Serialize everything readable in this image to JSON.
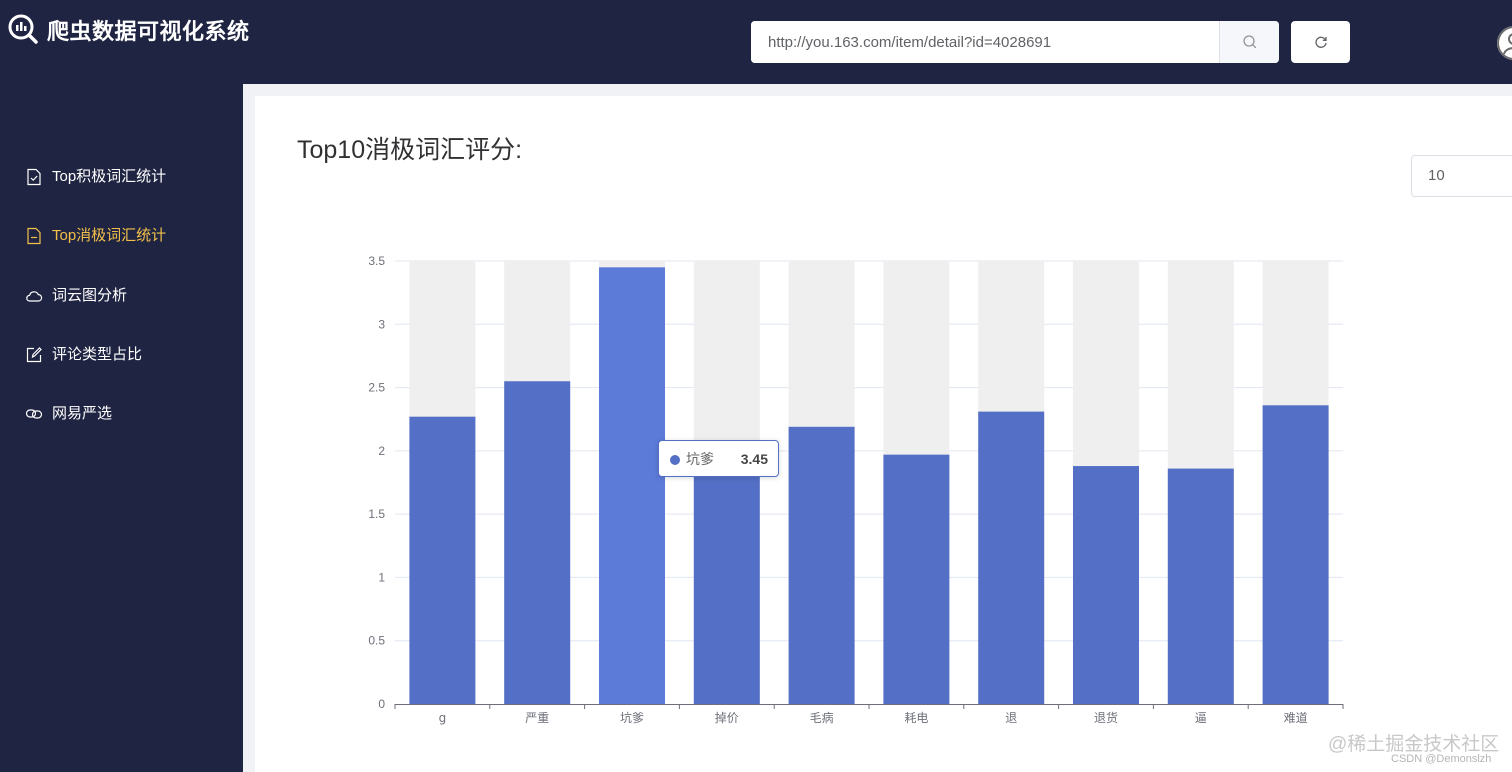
{
  "app": {
    "title": "爬虫数据可视化系统",
    "logo_icon": "bar-chart-search-icon"
  },
  "header": {
    "url_value": "http://you.163.com/item/detail?id=4028691",
    "search_icon": "search-icon",
    "refresh_icon": "refresh-icon",
    "avatar_icon": "user-avatar-icon"
  },
  "sidebar": {
    "items": [
      {
        "label": "Top积极词汇统计",
        "icon": "document-check-icon",
        "active": false
      },
      {
        "label": "Top消极词汇统计",
        "icon": "document-minus-icon",
        "active": true
      },
      {
        "label": "词云图分析",
        "icon": "cloud-icon",
        "active": false
      },
      {
        "label": "评论类型占比",
        "icon": "edit-icon",
        "active": false
      },
      {
        "label": "网易严选",
        "icon": "link-icon",
        "active": false
      }
    ]
  },
  "main": {
    "title": "Top10消极词汇评分:",
    "topn_value": "10"
  },
  "chart_data": {
    "type": "bar",
    "categories": [
      "g",
      "严重",
      "坑爹",
      "掉价",
      "毛病",
      "耗电",
      "退",
      "退货",
      "逼",
      "难道"
    ],
    "values": [
      2.27,
      2.55,
      3.45,
      1.95,
      2.19,
      1.97,
      2.31,
      1.88,
      1.86,
      2.36
    ],
    "ylim": [
      0,
      3.5
    ],
    "yticks": [
      0,
      0.5,
      1,
      1.5,
      2,
      2.5,
      3,
      3.5
    ],
    "background_bars": true,
    "bar_color": "#5470c6",
    "highlight_color": "#5c7bd9",
    "background_color": "#efefef",
    "highlighted_category": "坑爹",
    "grid": true
  },
  "tooltip": {
    "name": "坑爹",
    "value": "3.45"
  },
  "watermark": {
    "text": "@稀土掘金技术社区",
    "csdn": "CSDN @Demonslzh"
  }
}
